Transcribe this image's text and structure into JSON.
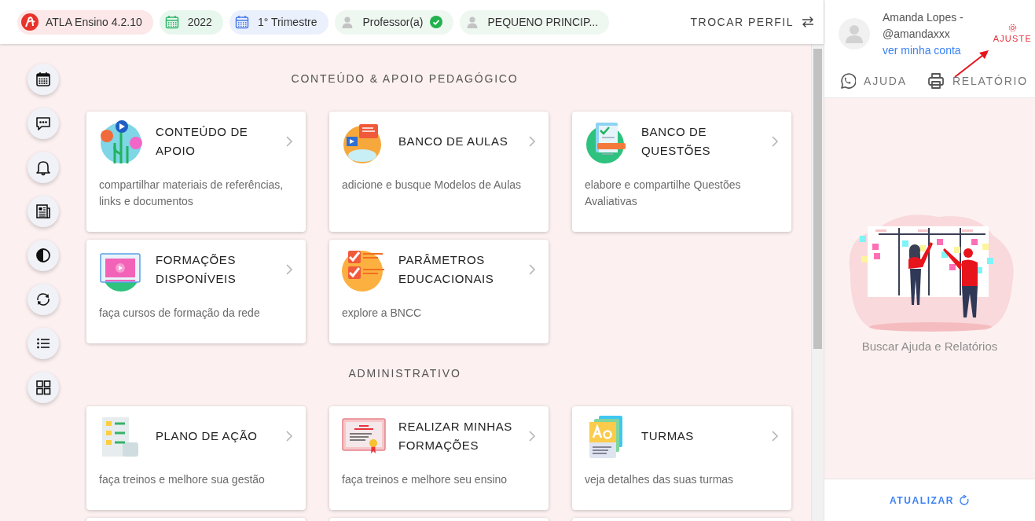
{
  "topbar": {
    "chips": [
      {
        "kind": "logo",
        "label": "ATLA Ensino 4.2.10",
        "color": "#e8322b",
        "verified": false
      },
      {
        "kind": "calendar",
        "label": "2022",
        "color": "#2eb568",
        "verified": false
      },
      {
        "kind": "calendar",
        "label": "1° Trimestre",
        "color": "#4a7bea",
        "verified": false
      },
      {
        "kind": "user",
        "label": "Professor(a)",
        "color": "#c4c4c4",
        "verified": true
      },
      {
        "kind": "user",
        "label": "PEQUENO PRINCIP...",
        "color": "#c4c4c4",
        "verified": false
      }
    ],
    "switch_profile": "TROCAR PERFIL"
  },
  "sections": [
    {
      "title": "CONTEÚDO & APOIO PEDAGÓGICO",
      "cards": [
        {
          "title": "CONTEÚDO DE APOIO",
          "description": "compartilhar materiais de referências, links e documentos"
        },
        {
          "title": "BANCO DE AULAS",
          "description": "adicione e busque Modelos de Aulas"
        },
        {
          "title": "BANCO DE QUESTÕES",
          "description": "elabore e compartilhe Questões Avaliativas"
        },
        {
          "title": "FORMAÇÕES DISPONÍVEIS",
          "description": "faça cursos de formação da rede"
        },
        {
          "title": "PARÂMETROS EDUCACIONAIS",
          "description": "explore a BNCC"
        }
      ]
    },
    {
      "title": "ADMINISTRATIVO",
      "cards": [
        {
          "title": "PLANO DE AÇÃO",
          "description": "faça treinos e melhore sua gestão"
        },
        {
          "title": "REALIZAR MINHAS FORMAÇÕES",
          "description": "faça treinos e melhore seu ensino"
        },
        {
          "title": "TURMAS",
          "description": "veja detalhes das suas turmas"
        }
      ]
    }
  ],
  "side_panel": {
    "user": {
      "name": "Amanda Lopes -",
      "handle": "@amandaxxx",
      "account_link": "ver minha conta"
    },
    "settings": "AJUSTE",
    "actions": [
      {
        "kind": "help",
        "label": "AJUDA"
      },
      {
        "kind": "report",
        "label": "RELATÓRIO"
      }
    ],
    "caption": "Buscar Ajuda e Relatórios",
    "refresh": "ATUALIZAR"
  }
}
